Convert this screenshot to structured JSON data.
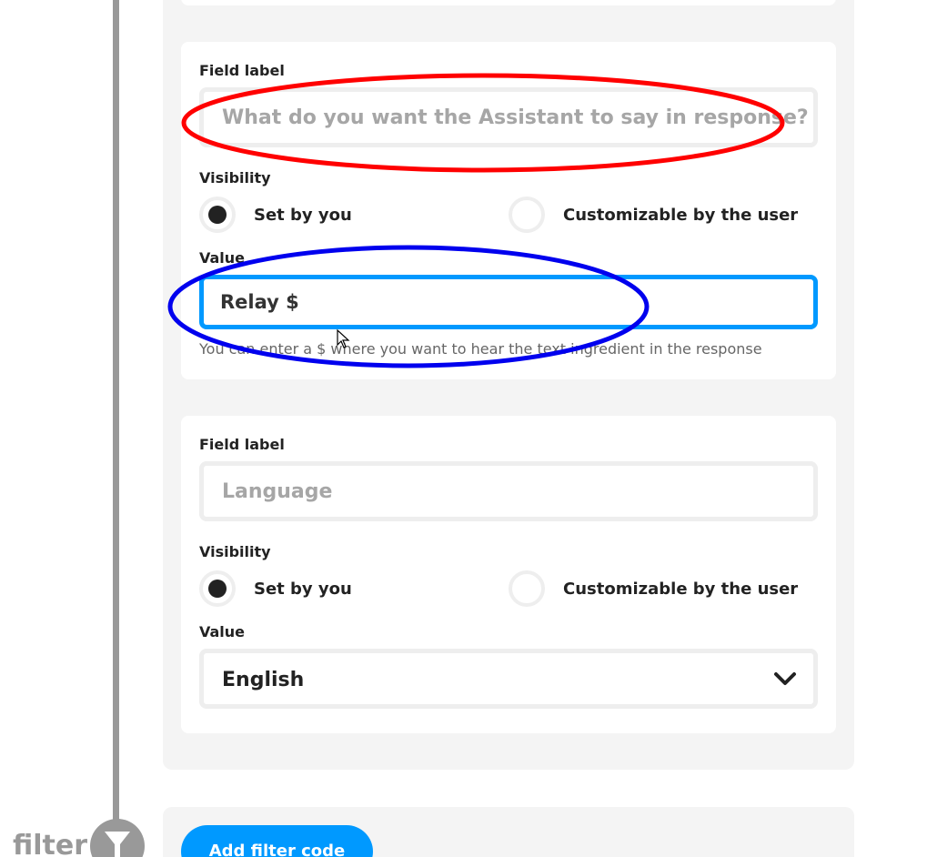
{
  "timeline": {
    "filter_label": "filter"
  },
  "field_blocks": [
    {
      "field_label_heading": "Field label",
      "field_label_placeholder": "What do you want the Assistant to say in response?",
      "visibility_heading": "Visibility",
      "option_set_by_you": "Set by you",
      "option_customizable": "Customizable by the user",
      "selected_option": "Set by you",
      "value_heading": "Value",
      "value": "Relay $",
      "helper_text": "You can enter a $ where you want to hear the text ingredient in the response"
    },
    {
      "field_label_heading": "Field label",
      "field_label_placeholder": "Language",
      "visibility_heading": "Visibility",
      "option_set_by_you": "Set by you",
      "option_customizable": "Customizable by the user",
      "selected_option": "Set by you",
      "value_heading": "Value",
      "value": "English"
    }
  ],
  "add_filter_button": "Add filter code",
  "icons": {
    "filter": "filter-funnel-icon",
    "dropdown": "chevron-down-icon",
    "cursor": "mouse-pointer-icon"
  },
  "colors": {
    "accent": "#0099ff",
    "annotation_red": "#ff0000",
    "annotation_blue": "#0000ee",
    "timeline_grey": "#999999"
  }
}
